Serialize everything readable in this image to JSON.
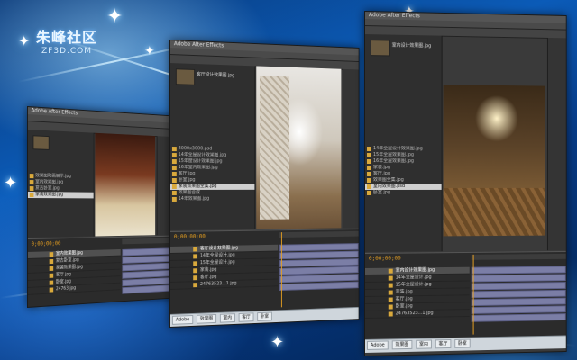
{
  "logo": {
    "cn": "朱峰社区",
    "en": "ZF3D.COM"
  },
  "windows": [
    {
      "id": "left",
      "title": "Adobe After Effects",
      "timecode": "0;00;00;00",
      "project_rows": [
        "效果图动画展示.jpg",
        "室内效果图.jpg",
        "复古卧室.jpg",
        "家装效果图.jpg"
      ],
      "selected_row": 3,
      "layers": [
        "室内效果图.jpg",
        "复古卧室.jpg",
        "家装效果图.jpg",
        "客厅.jpg",
        "卧室.jpg",
        "24763.jpg"
      ],
      "selected_layer": 0,
      "tasks": []
    },
    {
      "id": "middle",
      "title": "Adobe After Effects",
      "project_name": "客厅设计效果图.jpg",
      "timecode": "0;00;00;00",
      "project_rows": [
        "4000x3000.psd",
        "14年全屋设计效果图.jpg",
        "15年度设计效果图.jpg",
        "16年室内效果图.jpg",
        "客厅.jpg",
        "卧室.jpg",
        "家装效果图全集.jpg",
        "效果图合成",
        "14年效果图.jpg"
      ],
      "selected_row": 6,
      "layers": [
        "客厅设计效果图.jpg",
        "14年全屋设计.jpg",
        "15年全屋设计.jpg",
        "家装.jpg",
        "客厅.jpg",
        "24763523...1.jpg"
      ],
      "selected_layer": 0,
      "tasks": [
        "Adobe",
        "效果图",
        "室内",
        "客厅",
        "卧室"
      ]
    },
    {
      "id": "right",
      "title": "Adobe After Effects",
      "project_name": "室内设计效果图.jpg",
      "timecode": "0;00;00;00",
      "project_rows": [
        "14年全屋设计效果图.jpg",
        "15年全屋效果图.jpg",
        "16年全屋效果图.jpg",
        "家装.jpg",
        "客厅.jpg",
        "效果图全集.jpg",
        "室内效果图.psd",
        "卧室.jpg"
      ],
      "selected_row": 6,
      "layers": [
        "室内设计效果图.jpg",
        "14年全屋设计.jpg",
        "15年全屋设计.jpg",
        "家装.jpg",
        "客厅.jpg",
        "卧室.jpg",
        "24763523...1.jpg"
      ],
      "selected_layer": 0,
      "tasks": [
        "Adobe",
        "效果图",
        "室内",
        "客厅",
        "卧室"
      ]
    }
  ]
}
